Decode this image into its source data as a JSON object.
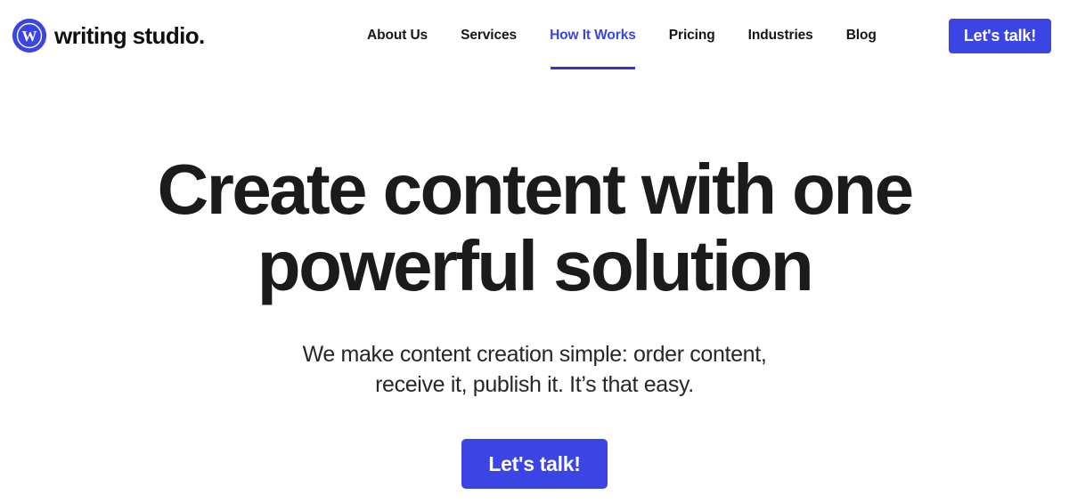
{
  "theme": {
    "accent": "#3b45e4",
    "accent_dark": "#2f36d6",
    "text": "#1b1b1b",
    "background": "#ffffff"
  },
  "header": {
    "logo": {
      "mark_letter": "W",
      "icon": "w-circle-logo-icon",
      "wordmark": "writing studio."
    },
    "nav": [
      {
        "label": "About Us",
        "active": false
      },
      {
        "label": "Services",
        "active": false
      },
      {
        "label": "How It Works",
        "active": true
      },
      {
        "label": "Pricing",
        "active": false
      },
      {
        "label": "Industries",
        "active": false
      },
      {
        "label": "Blog",
        "active": false
      }
    ],
    "cta_label": "Let's talk!"
  },
  "hero": {
    "title_line1": "Create content with one",
    "title_line2": "powerful solution",
    "sub_line1": "We make content creation simple: order content,",
    "sub_line2": "receive it, publish it. It’s that easy.",
    "cta_label": "Let's talk!"
  }
}
